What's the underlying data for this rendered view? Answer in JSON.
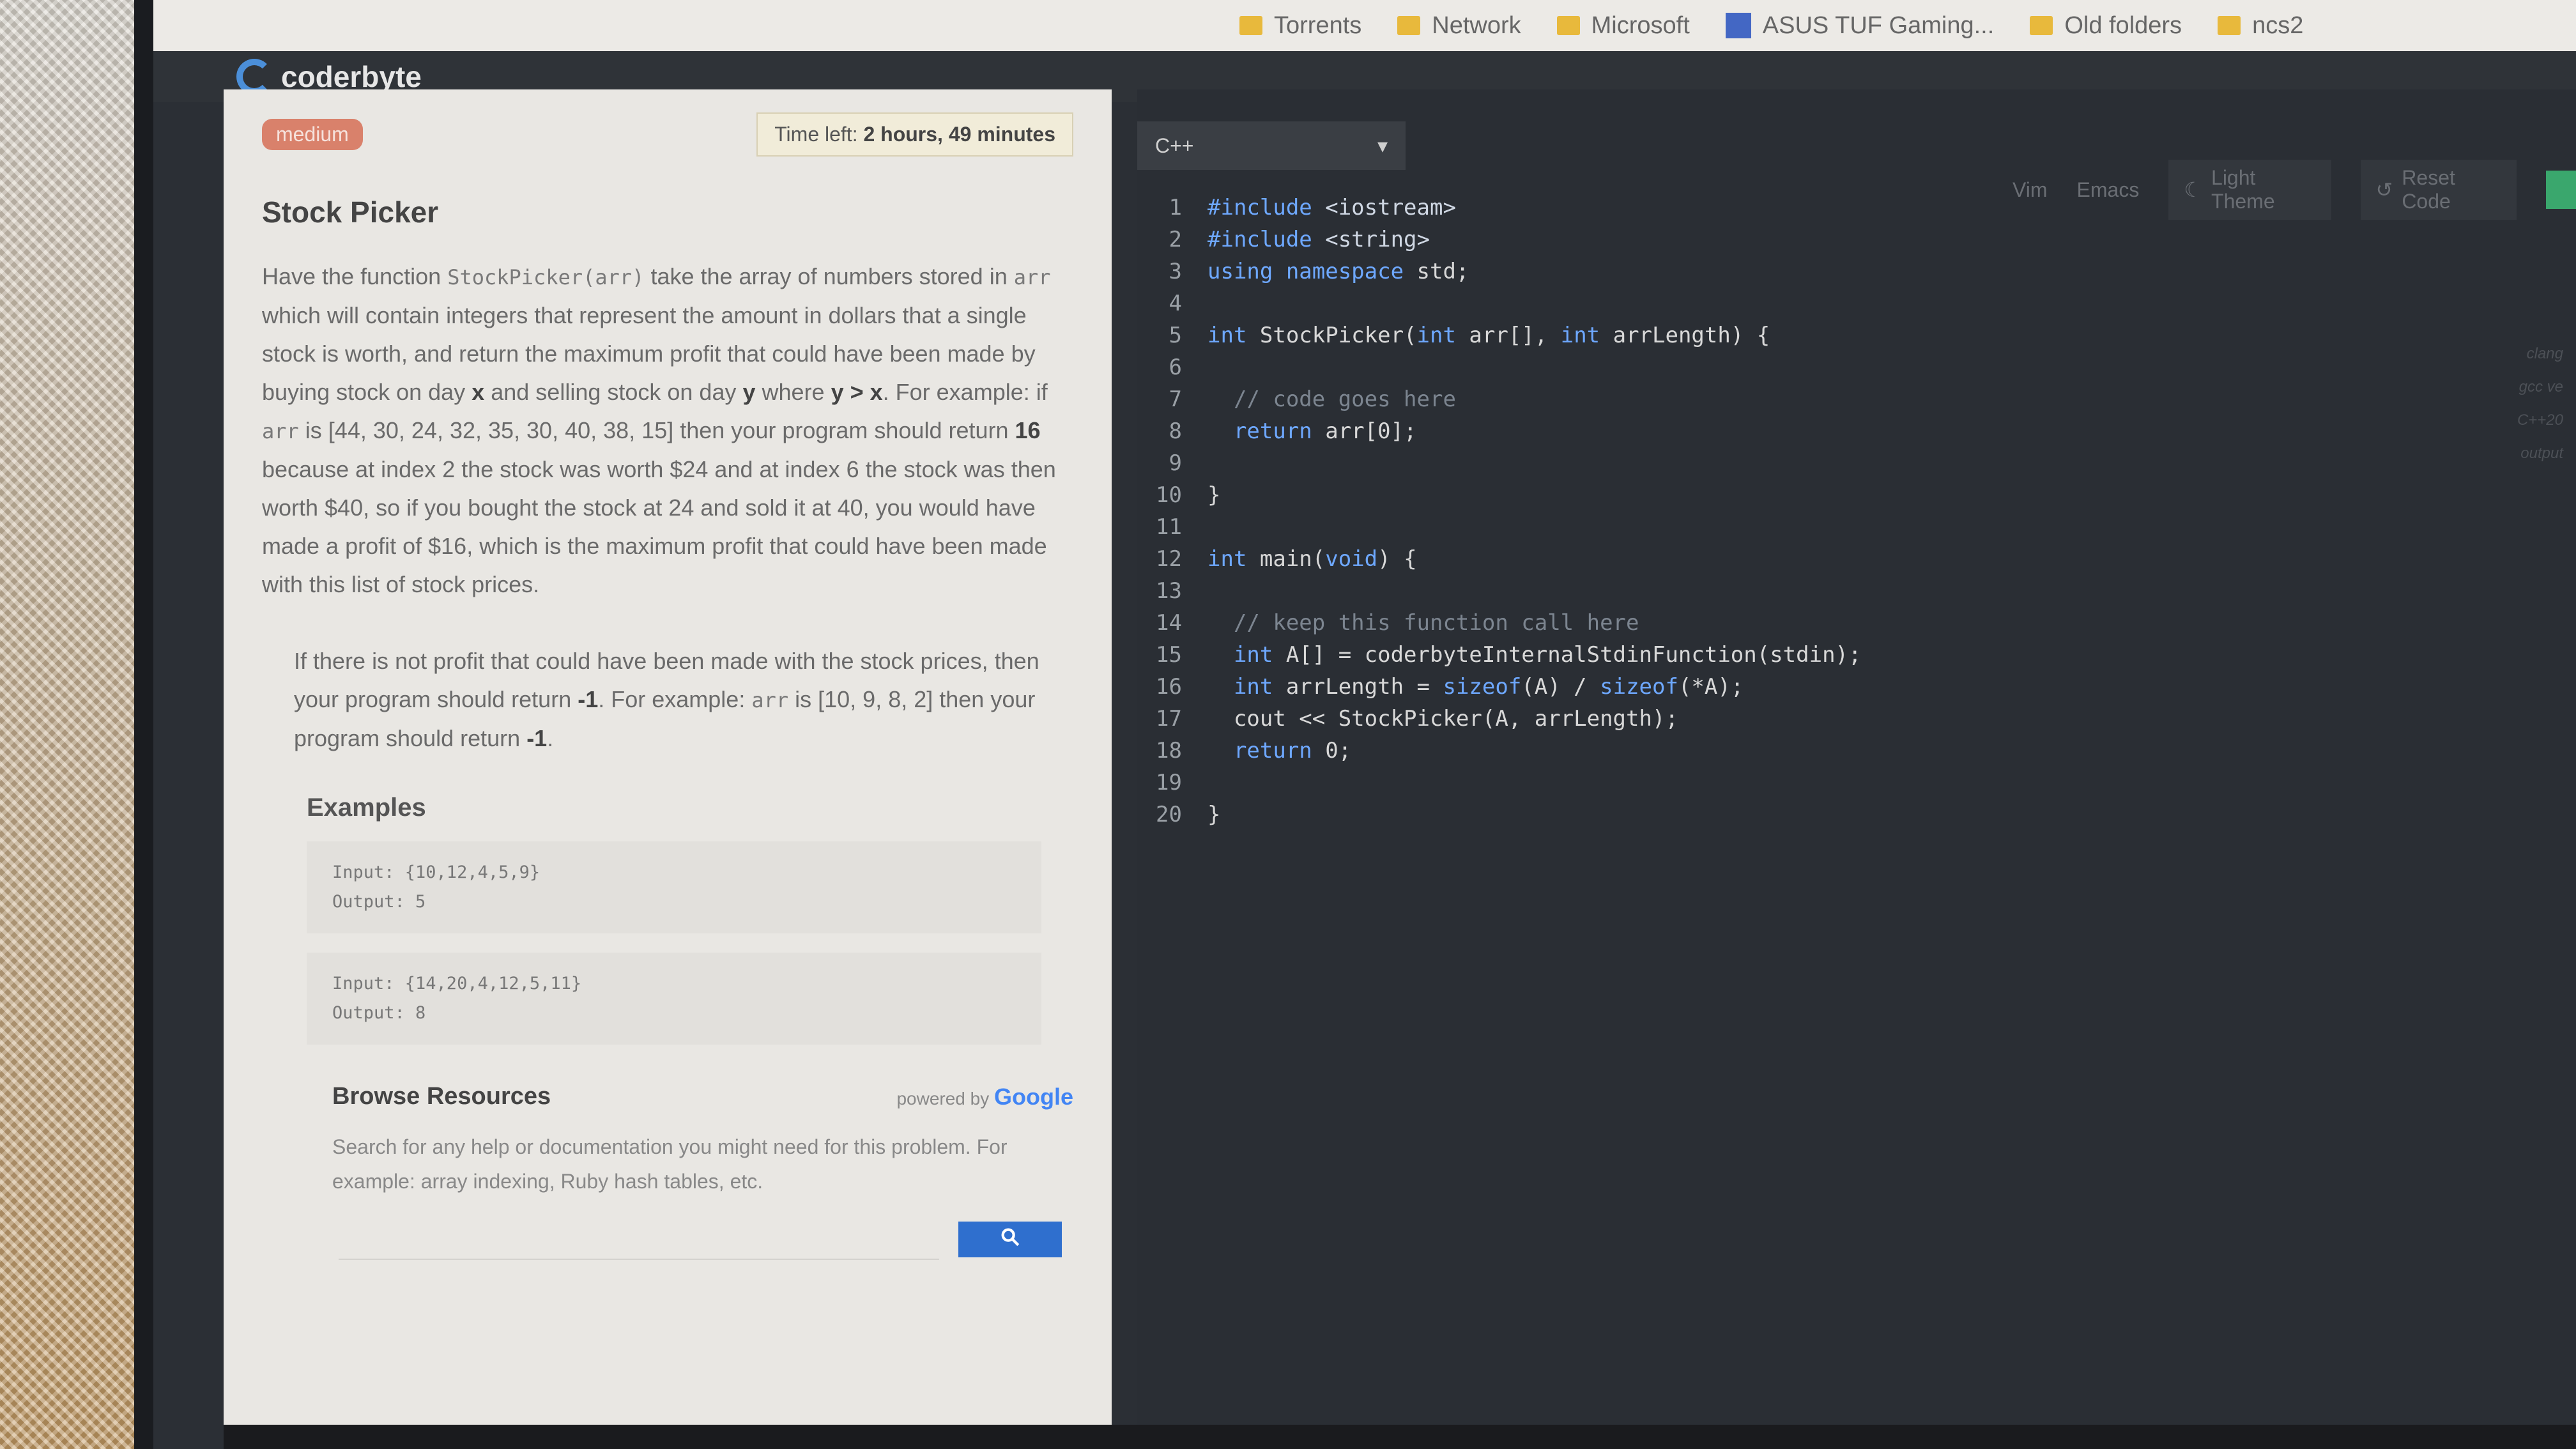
{
  "bookmarks": [
    {
      "label": "Torrents",
      "icon": "folder-icon"
    },
    {
      "label": "Network",
      "icon": "folder-icon"
    },
    {
      "label": "Microsoft",
      "icon": "folder-icon"
    },
    {
      "label": "ASUS TUF Gaming...",
      "icon": "asus-icon"
    },
    {
      "label": "Old folders",
      "icon": "folder-icon"
    },
    {
      "label": "ncs2",
      "icon": "folder-icon"
    }
  ],
  "app": {
    "logo": "coderbyte"
  },
  "problem": {
    "difficulty": "medium",
    "timer_label": "Time left:",
    "timer_value": "2 hours, 49 minutes",
    "title": "Stock Picker",
    "p1": {
      "t1": "Have the function ",
      "c1": "StockPicker(arr)",
      "t2": " take the array of numbers stored in ",
      "c2": "arr",
      "t3": " which will contain integers that represent the amount in dollars that a single stock is worth, and return the maximum profit that could have been made by buying stock on day ",
      "b1": "x",
      "t4": " and selling stock on day ",
      "b2": "y",
      "t5": " where ",
      "b3": "y > x",
      "t6": ". For example: if ",
      "c3": "arr",
      "t7": " is [44, 30, 24, 32, 35, 30, 40, 38, 15] then your program should return ",
      "b4": "16",
      "t8": " because at index 2 the stock was worth $24 and at index 6 the stock was then worth $40, so if you bought the stock at 24 and sold it at 40, you would have made a profit of $16, which is the maximum profit that could have been made with this list of stock prices."
    },
    "p2": {
      "t1": "If there is not profit that could have been made with the stock prices, then your program should return ",
      "b1": "-1",
      "t2": ". For example: ",
      "c1": "arr",
      "t3": " is [10, 9, 8, 2] then your program should return ",
      "b2": "-1",
      "t4": "."
    },
    "examples_title": "Examples",
    "examples": [
      {
        "input": "Input: {10,12,4,5,9}",
        "output": "Output: 5"
      },
      {
        "input": "Input: {14,20,4,12,5,11}",
        "output": "Output: 8"
      }
    ],
    "browse_title": "Browse Resources",
    "powered_by": "powered by",
    "google": "Google",
    "browse_text": "Search for any help or documentation you might need for this problem. For example: array indexing, Ruby hash tables, etc."
  },
  "editor": {
    "language": "C++",
    "toolbar": {
      "vim": "Vim",
      "emacs": "Emacs",
      "theme": "Light Theme",
      "reset": "Reset Code"
    },
    "side_labels": [
      "clang",
      "gcc ve",
      "C++20",
      "output"
    ],
    "lines": [
      {
        "n": "1",
        "parts": [
          [
            "kw",
            "#include "
          ],
          [
            "str",
            "<iostream>"
          ]
        ]
      },
      {
        "n": "2",
        "parts": [
          [
            "kw",
            "#include "
          ],
          [
            "str",
            "<string>"
          ]
        ]
      },
      {
        "n": "3",
        "parts": [
          [
            "kw",
            "using namespace "
          ],
          [
            "src",
            "std;"
          ]
        ]
      },
      {
        "n": "4",
        "parts": []
      },
      {
        "n": "5",
        "parts": [
          [
            "kw",
            "int "
          ],
          [
            "src",
            "StockPicker("
          ],
          [
            "kw",
            "int "
          ],
          [
            "src",
            "arr[], "
          ],
          [
            "kw",
            "int "
          ],
          [
            "src",
            "arrLength) {"
          ]
        ]
      },
      {
        "n": "6",
        "parts": []
      },
      {
        "n": "7",
        "parts": [
          [
            "cm",
            "  // code goes here"
          ]
        ]
      },
      {
        "n": "8",
        "parts": [
          [
            "kw",
            "  return "
          ],
          [
            "src",
            "arr[0];"
          ]
        ]
      },
      {
        "n": "9",
        "parts": []
      },
      {
        "n": "10",
        "parts": [
          [
            "src",
            "}"
          ]
        ]
      },
      {
        "n": "11",
        "parts": []
      },
      {
        "n": "12",
        "parts": [
          [
            "kw",
            "int "
          ],
          [
            "src",
            "main("
          ],
          [
            "kw",
            "void"
          ],
          [
            "src",
            ") {"
          ]
        ]
      },
      {
        "n": "13",
        "parts": []
      },
      {
        "n": "14",
        "parts": [
          [
            "cm",
            "  // keep this function call here"
          ]
        ]
      },
      {
        "n": "15",
        "parts": [
          [
            "kw",
            "  int "
          ],
          [
            "src",
            "A[] = coderbyteInternalStdinFunction(stdin);"
          ]
        ]
      },
      {
        "n": "16",
        "parts": [
          [
            "kw",
            "  int "
          ],
          [
            "src",
            "arrLength = "
          ],
          [
            "kw",
            "sizeof"
          ],
          [
            "src",
            "(A) / "
          ],
          [
            "kw",
            "sizeof"
          ],
          [
            "src",
            "(*A);"
          ]
        ]
      },
      {
        "n": "17",
        "parts": [
          [
            "src",
            "  cout << StockPicker(A, arrLength);"
          ]
        ]
      },
      {
        "n": "18",
        "parts": [
          [
            "kw",
            "  return "
          ],
          [
            "src",
            "0;"
          ]
        ]
      },
      {
        "n": "19",
        "parts": []
      },
      {
        "n": "20",
        "parts": [
          [
            "src",
            "}"
          ]
        ]
      }
    ]
  }
}
